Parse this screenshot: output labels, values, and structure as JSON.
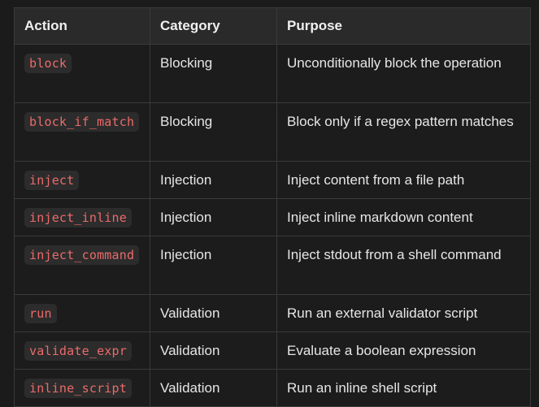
{
  "table": {
    "headers": [
      "Action",
      "Category",
      "Purpose"
    ],
    "rows": [
      {
        "action": "block",
        "category": "Blocking",
        "purpose": "Unconditionally block the operation"
      },
      {
        "action": "block_if_match",
        "category": "Blocking",
        "purpose": "Block only if a regex pattern matches"
      },
      {
        "action": "inject",
        "category": "Injection",
        "purpose": "Inject content from a file path"
      },
      {
        "action": "inject_inline",
        "category": "Injection",
        "purpose": "Inject inline markdown content"
      },
      {
        "action": "inject_command",
        "category": "Injection",
        "purpose": "Inject stdout from a shell command"
      },
      {
        "action": "run",
        "category": "Validation",
        "purpose": "Run an external validator script"
      },
      {
        "action": "validate_expr",
        "category": "Validation",
        "purpose": "Evaluate a boolean expression"
      },
      {
        "action": "inline_script",
        "category": "Validation",
        "purpose": "Run an inline shell script"
      }
    ]
  },
  "colors": {
    "background": "#1b1b1b",
    "header_background": "#2a2a2a",
    "border": "#3a3a3a",
    "code_text": "#ec6a6a",
    "code_background": "#2c2c2c",
    "text": "#e6e6e6"
  }
}
